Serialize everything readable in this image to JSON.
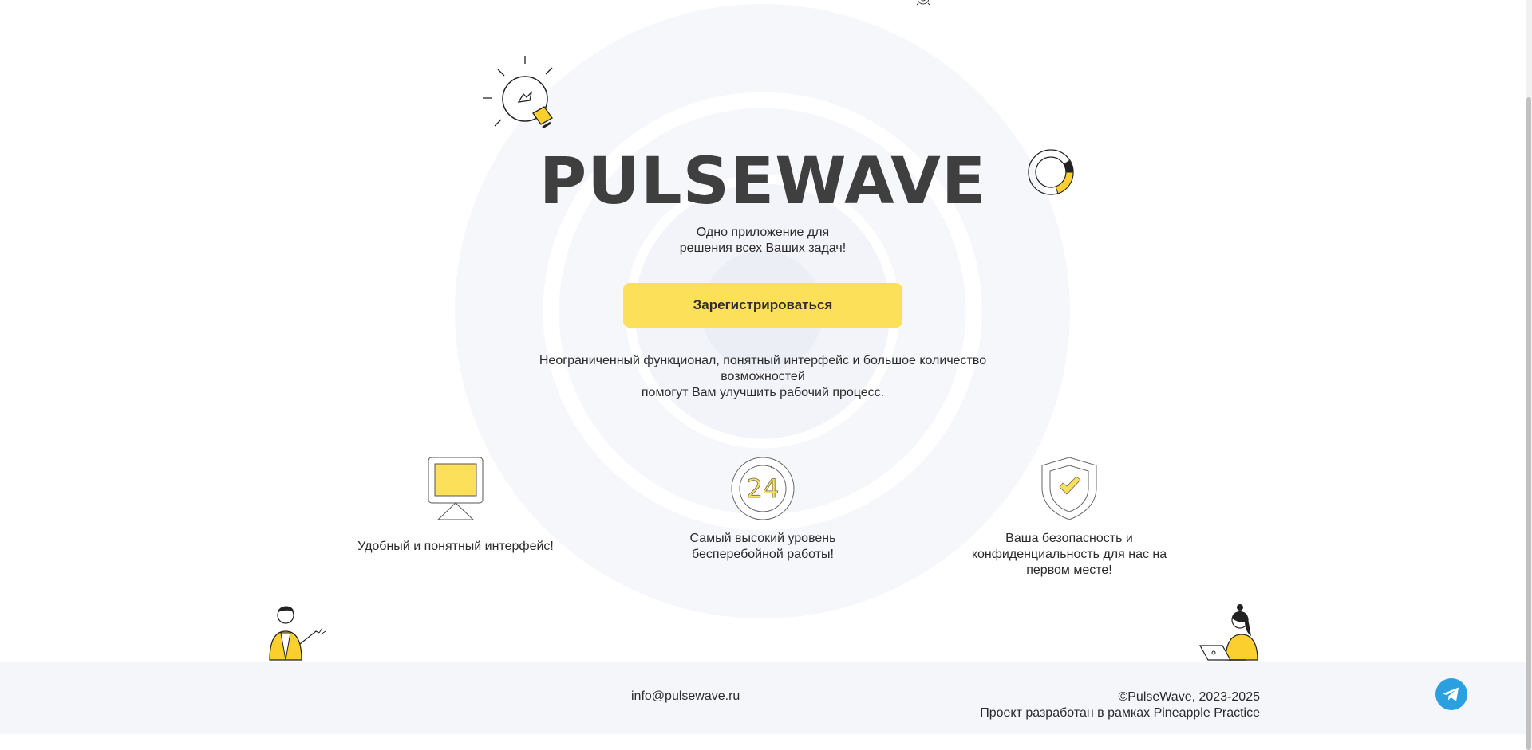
{
  "brand": {
    "logo": "PULSEWAVE"
  },
  "hero": {
    "subtitle": "Одно приложение для\nрешения всех Ваших задач!",
    "cta_label": "Зарегистрироваться",
    "lead": "Неограниченный функционал, понятный интерфейс и большое количество\nвозможностей\nпомогут Вам улучшить рабочий процесс."
  },
  "features": [
    {
      "icon": "monitor-icon",
      "text": "Удобный и понятный интерфейс!"
    },
    {
      "icon": "clock-24-icon",
      "number": "24",
      "text": "Самый высокий уровень\nбесперебойной работы!"
    },
    {
      "icon": "shield-check-icon",
      "text": "Ваша безопасность и\nконфиденциальность для нас на\nпервом месте!"
    }
  ],
  "footer": {
    "email": "info@pulsewave.ru",
    "copyright": "©PulseWave, 2023-2025",
    "credit": "Проект разработан в рамках Pineapple Practice"
  },
  "decor": [
    "lightbulb-icon",
    "donut-chart-icon",
    "gear-icon",
    "man-illustration",
    "woman-laptop-illustration",
    "telegram-icon"
  ],
  "colors": {
    "accent": "#fde05a",
    "text": "#2b2b2b",
    "logo": "#3f3f3f",
    "footer_bg": "#f5f6fa",
    "telegram": "#2ba0e0",
    "ring_outer": "#f6f7fb",
    "ring_inner": "#eceef6"
  }
}
